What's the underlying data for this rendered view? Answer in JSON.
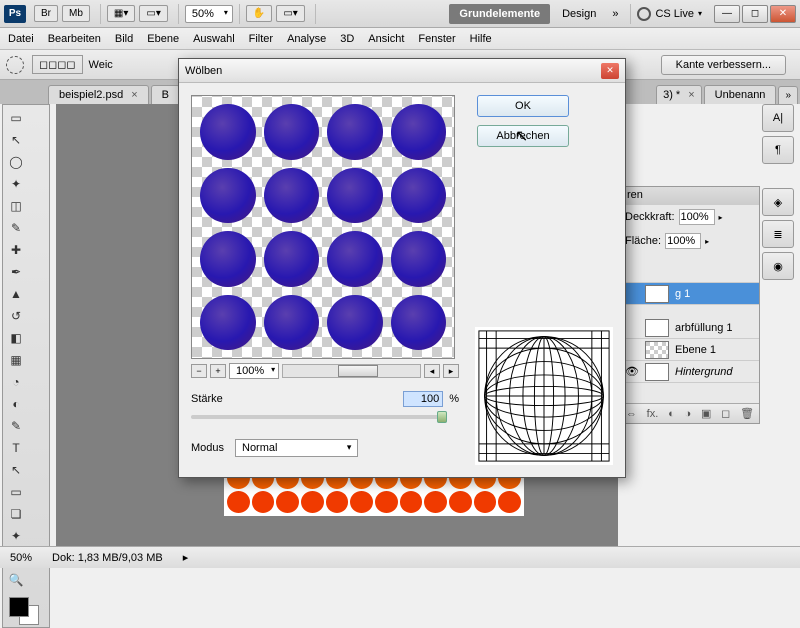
{
  "titlebar": {
    "app": "Ps",
    "br": "Br",
    "mb": "Mb",
    "zoom": "50%",
    "workspace_active": "Grundelemente",
    "workspace_other": "Design",
    "cslive": "CS Live"
  },
  "menu": [
    "Datei",
    "Bearbeiten",
    "Bild",
    "Ebene",
    "Auswahl",
    "Filter",
    "Analyse",
    "3D",
    "Ansicht",
    "Fenster",
    "Hilfe"
  ],
  "optionsbar": {
    "weich": "Weic",
    "refine": "Kante verbessern..."
  },
  "doctabs": {
    "tab1": "beispiel2.psd",
    "tab2": "B",
    "tabmore": "3) *",
    "tabnew": "Unbenann"
  },
  "layers": {
    "tabs": "ren",
    "opacity_label": "Deckkraft:",
    "opacity_value": "100%",
    "fill_label": "Fläche:",
    "fill_value": "100%",
    "items": [
      {
        "name": "g 1",
        "selected": true
      },
      {
        "name": "arbfüllung 1"
      },
      {
        "name": "Ebene 1"
      },
      {
        "name": "Hintergrund"
      }
    ]
  },
  "dialog": {
    "title": "Wölben",
    "ok": "OK",
    "cancel": "Abbrechen",
    "zoom": "100%",
    "strength_label": "Stärke",
    "strength_value": "100",
    "percent": "%",
    "mode_label": "Modus",
    "mode_value": "Normal"
  },
  "statusbar": {
    "zoom": "50%",
    "doc": "Dok: 1,83 MB/9,03 MB"
  }
}
